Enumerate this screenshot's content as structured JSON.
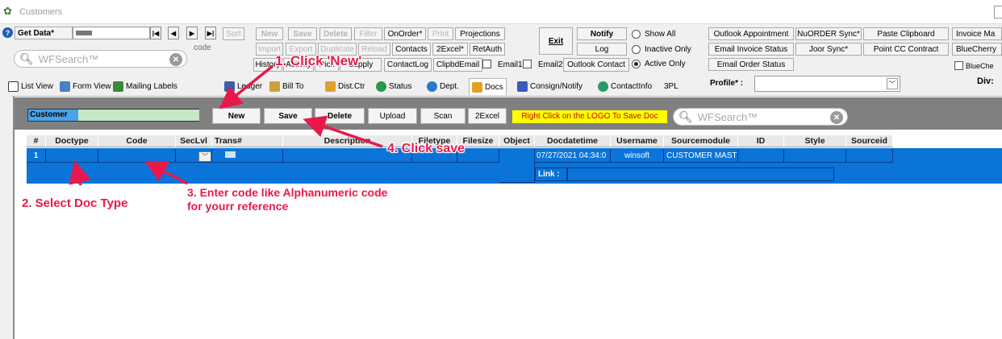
{
  "window": {
    "title": "Customers"
  },
  "toolbar": {
    "get_data": "Get Data*",
    "sort": "Sort",
    "code_label": "code",
    "search_placeholder": "WFSearch™",
    "row1": [
      "New",
      "Save",
      "Delete",
      "Filter",
      "OnOrder*",
      "Print",
      "Projections"
    ],
    "row2": [
      "Import",
      "Export",
      "Duplicate",
      "Reload",
      "Contacts",
      "2Excel*",
      "RetAuth"
    ],
    "row3": [
      "History",
      "Activity",
      "Pick",
      "Supply",
      "ContactLog",
      "ClipbdEmail",
      "Email1",
      "Email2",
      "Outlook Contact"
    ],
    "exit": "Exit",
    "notify": "Notify",
    "log": "Log",
    "radios": [
      {
        "label": "Show All",
        "on": false
      },
      {
        "label": "Inactive Only",
        "on": false
      },
      {
        "label": "Active Only",
        "on": true
      }
    ],
    "right_buttons": [
      "Outlook Appointment",
      "NuORDER Sync*",
      "Paste Clipboard",
      "Invoice Ma",
      "Email Invoice Status",
      "Joor Sync*",
      "Point CC Contract",
      "BlueCherry",
      "Email Order Status"
    ],
    "bluecher_check": "BlueChe",
    "profile_label": "Profile* :",
    "div_label": "Div:"
  },
  "tabs": [
    "List View",
    "Form View",
    "Mailing Labels",
    "Ledger",
    "Bill To",
    "Dist.Ctr",
    "Status",
    "Dept.",
    "Docs",
    "Consign/Notify",
    "ContactInfo",
    "3PL"
  ],
  "docs": {
    "customer_label": "Customer",
    "buttons": [
      "New",
      "Save",
      "Delete",
      "Upload",
      "Scan",
      "2Excel"
    ],
    "hint": "Right Click on the LOGO To Save Doc",
    "search_placeholder": "WFSearch™",
    "columns": [
      "#",
      "Doctype",
      "Code",
      "SecLvl",
      "Trans#",
      "Description",
      "Filetype",
      "Filesize",
      "Object",
      "Docdatetime",
      "Username",
      "Sourcemodule",
      "ID",
      "Style",
      "Sourceid"
    ],
    "row": {
      "num": "1",
      "datetime": "07/27/2021 04:34:0",
      "username": "winsoft",
      "sourcemodule": "CUSTOMER MAST",
      "link_label": "Link :"
    }
  },
  "annotations": {
    "a1": "1. Click 'New'",
    "a2": "2. Select Doc Type",
    "a3_line1": "3. Enter code like Alphanumeric code",
    "a3_line2": "for yourr reference",
    "a4": "4. Click save",
    "color": "#e8194a"
  },
  "colors": {
    "row_blue": "#0a74d9",
    "hint_yellow": "#ffff00",
    "customer_field": "#c6e8c6"
  }
}
